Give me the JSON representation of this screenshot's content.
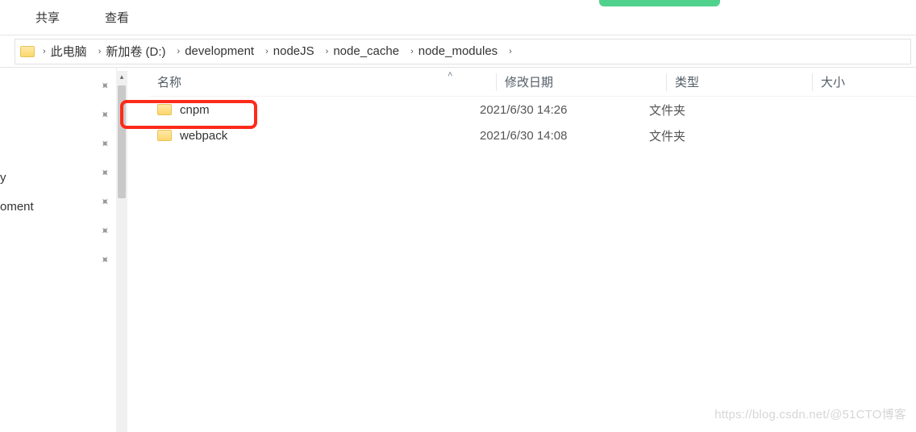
{
  "ribbon": {
    "tabs": [
      "共享",
      "查看"
    ]
  },
  "breadcrumb": [
    "此电脑",
    "新加卷 (D:)",
    "development",
    "nodeJS",
    "node_cache",
    "node_modules"
  ],
  "headers": {
    "name": "名称",
    "date": "修改日期",
    "type": "类型",
    "size": "大小"
  },
  "rows": [
    {
      "name": "cnpm",
      "date": "2021/6/30 14:26",
      "type": "文件夹"
    },
    {
      "name": "webpack",
      "date": "2021/6/30 14:08",
      "type": "文件夹"
    }
  ],
  "left_stub": {
    "item1": "y",
    "item2": "oment"
  },
  "watermark": "https://blog.csdn.net/@51CTO博客"
}
